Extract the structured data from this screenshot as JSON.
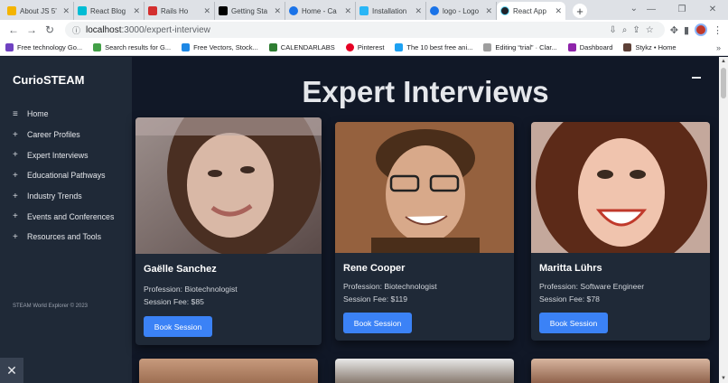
{
  "browser": {
    "tabs": [
      {
        "title": "About JS 5’",
        "color": "#f4b400"
      },
      {
        "title": "React Blog",
        "color": "#00bcd4"
      },
      {
        "title": "Rails Ho",
        "color": "#d32f2f"
      },
      {
        "title": "Getting Sta",
        "color": "#000000"
      },
      {
        "title": "Home - Ca",
        "color": "#1a73e8"
      },
      {
        "title": "Installation",
        "color": "#29b6f6"
      },
      {
        "title": "logo - Logo",
        "color": "#1a73e8"
      },
      {
        "title": "React App",
        "color": "#61dafb"
      }
    ],
    "new_tab": "+",
    "url_host": "localhost",
    "url_path": ":3000/expert-interview",
    "bookmarks": [
      {
        "label": "Free technology Go...",
        "color": "#6f42c1"
      },
      {
        "label": "Search results for G...",
        "color": "#43a047"
      },
      {
        "label": "Free Vectors, Stock...",
        "color": "#1e88e5"
      },
      {
        "label": "CALENDARLABS",
        "color": "#2e7d32"
      },
      {
        "label": "Pinterest",
        "color": "#e60023"
      },
      {
        "label": "The 10 best free ani...",
        "color": "#1da1f2"
      },
      {
        "label": "Editing “trial” · Clar...",
        "color": "#9e9e9e"
      },
      {
        "label": "Dashboard",
        "color": "#8e24aa"
      },
      {
        "label": "Stykz • Home",
        "color": "#5d4037"
      }
    ]
  },
  "sidebar": {
    "brand": "CurioSTEAM",
    "items": [
      {
        "icon": "≡",
        "label": "Home"
      },
      {
        "icon": "+",
        "label": "Career Profiles"
      },
      {
        "icon": "+",
        "label": "Expert Interviews"
      },
      {
        "icon": "+",
        "label": "Educational Pathways"
      },
      {
        "icon": "+",
        "label": "Industry Trends"
      },
      {
        "icon": "+",
        "label": "Events and Conferences"
      },
      {
        "icon": "+",
        "label": "Resources and Tools"
      }
    ],
    "copyright": "STEAM World Explorer © 2023",
    "close_icon": "✕"
  },
  "main": {
    "title": "Expert Interviews",
    "experts": [
      {
        "name": "Gaëlle Sanchez",
        "profession": "Profession: Biotechnologist",
        "fee": "Session Fee: $85",
        "button": "Book Session"
      },
      {
        "name": "Rene Cooper",
        "profession": "Profession: Biotechnologist",
        "fee": "Session Fee: $119",
        "button": "Book Session"
      },
      {
        "name": "Maritta Lührs",
        "profession": "Profession: Software Engineer",
        "fee": "Session Fee: $78",
        "button": "Book Session"
      }
    ]
  }
}
